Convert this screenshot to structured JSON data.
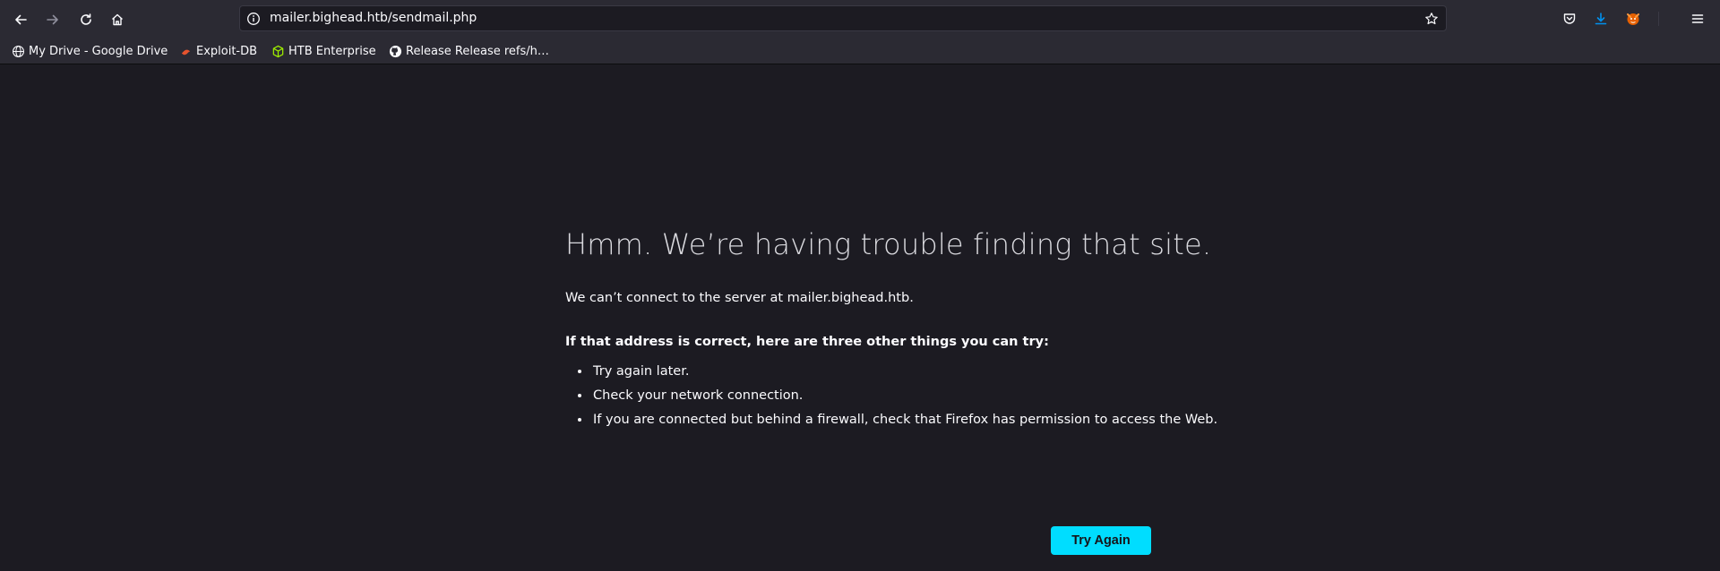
{
  "browser": {
    "url": "mailer.bighead.htb/sendmail.php",
    "bookmarks": [
      {
        "label": "My Drive - Google Drive",
        "icon": "globe-icon"
      },
      {
        "label": "Exploit-DB",
        "icon": "exploit-db-icon"
      },
      {
        "label": "HTB Enterprise",
        "icon": "htb-cube-icon"
      },
      {
        "label": "Release Release refs/h…",
        "icon": "github-icon"
      }
    ]
  },
  "error_page": {
    "title": "Hmm. We’re having trouble finding that site.",
    "description": "We can’t connect to the server at mailer.bighead.htb.",
    "suggestion_heading": "If that address is correct, here are three other things you can try:",
    "suggestions": [
      "Try again later.",
      "Check your network connection.",
      "If you are connected but behind a firewall, check that Firefox has permission to access the Web."
    ],
    "try_again_label": "Try Again"
  },
  "colors": {
    "accent": "#00ddff",
    "toolbar": "#2b2a33",
    "page_bg": "#1c1b22"
  }
}
